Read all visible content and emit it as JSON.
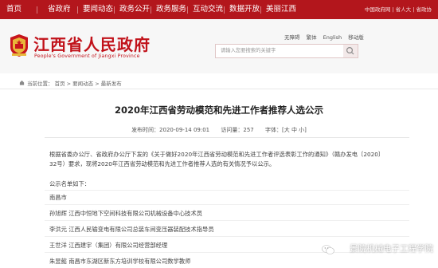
{
  "topnav": {
    "items": [
      "首页",
      "省政府",
      "要闻动态",
      "政务公开",
      "政务服务",
      "互动交流",
      "数据开放",
      "美丽江西"
    ],
    "right_links": "中国政府网 | 省人大 | 省政协"
  },
  "header": {
    "logo_cn": "江西省人民政府",
    "logo_en": "People's Government of Jiangxi Province",
    "links": [
      "无障碍",
      "繁体",
      "English",
      "移动版"
    ],
    "search_placeholder": "请输入您要搜索的关键字"
  },
  "breadcrumb": {
    "path": "当前位置： 首页 > 要闻动态 > 最新发布"
  },
  "article": {
    "title": "2020年江西省劳动模范和先进工作者推荐人选公示",
    "meta": {
      "date": "发布时间：2020-09-14 09:01",
      "views": "访问量：257",
      "font": "字体：[大 中 小]"
    },
    "intro_1": "根据省委办公厅、省政府办公厅下发的《关于做好2020年江西省劳动模范和先进工作者评选表彰工作的通知》（赣办发电〔2020〕",
    "intro_2": "32号）要求，现将2020年江西省劳动模范和先进工作者推荐人选的有关情况予以公示。",
    "list_header": "公示名单如下：",
    "region": "南昌市",
    "nominees": [
      "孙旭辉 江西中恒地下空间科技有限公司机械设备中心技术员",
      "李洪元 江西人民输变电有限公司总装车间变压器装配技术指导员",
      "王世洋 江西建宇（集团）有限公司经营部经理",
      "朱昱懿 南昌市东湖区新东方培训学校有限公司数学教师"
    ]
  },
  "watermark": "景院机械电子工程学院"
}
